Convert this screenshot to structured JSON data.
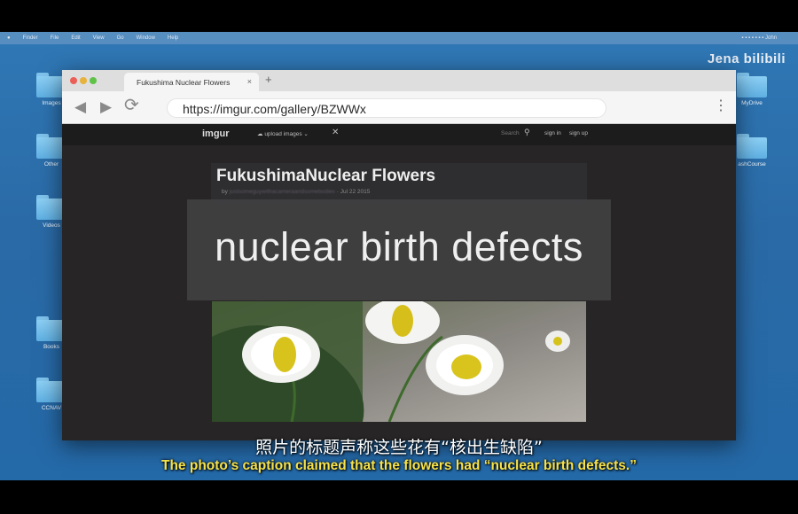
{
  "menubar": {
    "items": [
      "Finder",
      "File",
      "Edit",
      "View",
      "Go",
      "Window",
      "Help"
    ],
    "right": "▪ ▪ ▪ ▪ ▪ ▪ ▪  John"
  },
  "desktop": {
    "left_icons": [
      "Images",
      "Other",
      "Videos",
      "Books",
      "CCNAV"
    ],
    "right_icons": [
      "MyDrive",
      "ashCourse"
    ]
  },
  "watermark": "Jena bilibili",
  "browser": {
    "tab_title": "Fukushima Nuclear Flowers",
    "tab_close": "×",
    "new_tab": "+",
    "url": "https://imgur.com/gallery/BZWWx"
  },
  "imgur": {
    "logo": "imgur",
    "upload_label": "upload images",
    "search_label": "Search",
    "signin": "sign in",
    "signup": "sign up"
  },
  "post": {
    "title_a": "Fukushima",
    "title_b": "Nuclear Flowers",
    "meta_by": "by",
    "meta_user": "justsomeguywithacameraandsomebodies",
    "meta_date": "Jul 22 2015"
  },
  "overlay": {
    "text": "nuclear birth defects"
  },
  "subtitles": {
    "zh": "照片的标题声称这些花有“核出生缺陷”",
    "en": "The photo’s caption claimed that the flowers had “nuclear birth defects.”"
  },
  "colors": {
    "subtitle_en": "#f6e24a",
    "desktop_bg": "#2a6aa6",
    "page_bg": "#272526"
  }
}
